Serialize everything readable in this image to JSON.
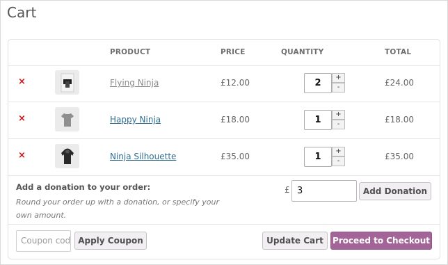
{
  "page": {
    "title": "Cart"
  },
  "table": {
    "headers": {
      "product": "PRODUCT",
      "price": "PRICE",
      "quantity": "QUANTITY",
      "total": "TOTAL"
    },
    "rows": [
      {
        "remove": "×",
        "name": "Flying Ninja",
        "price": "£12.00",
        "quantity": "2",
        "total": "£24.00",
        "thumb_icon": "poster-icon",
        "link_color": "#8a8a8a"
      },
      {
        "remove": "×",
        "name": "Happy Ninja",
        "price": "£18.00",
        "quantity": "1",
        "total": "£18.00",
        "thumb_icon": "tshirt-icon",
        "link_color": "#2f6d8e"
      },
      {
        "remove": "×",
        "name": "Ninja Silhouette",
        "price": "£35.00",
        "quantity": "1",
        "total": "£35.00",
        "thumb_icon": "hoodie-icon",
        "link_color": "#2f6d8e"
      }
    ],
    "stepper": {
      "plus": "+",
      "minus": "-"
    }
  },
  "donation": {
    "title": "Add a donation to your order:",
    "description": "Round your order up with a donation, or specify your own amount.",
    "currency": "£",
    "amount": "3",
    "button": "Add Donation"
  },
  "coupon": {
    "placeholder": "Coupon code",
    "button": "Apply Coupon"
  },
  "actions": {
    "update": "Update Cart",
    "checkout": "Proceed to Checkout"
  },
  "colors": {
    "remove": "#d01414",
    "checkout": "#a36597",
    "link": "#2f6d8e"
  }
}
